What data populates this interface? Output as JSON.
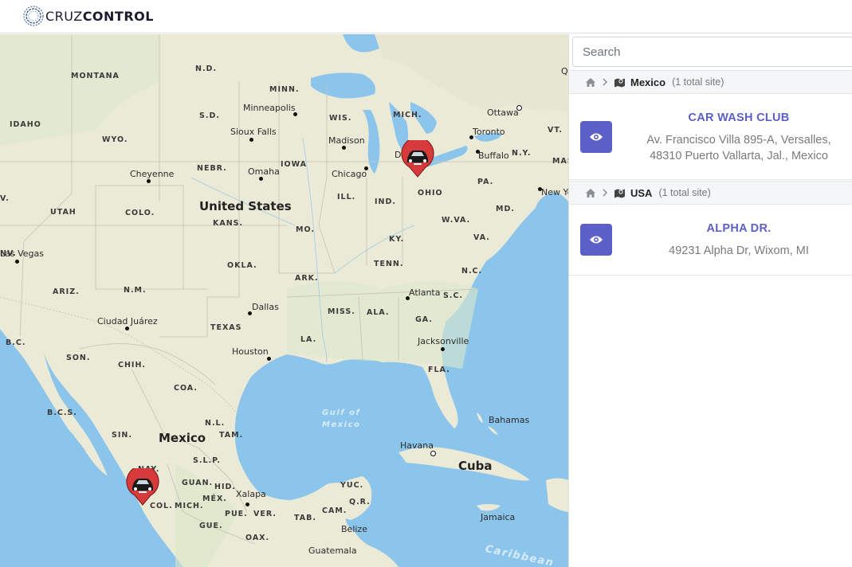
{
  "brand": {
    "name_light": "CRUZ",
    "name_bold": "CONTROL"
  },
  "search": {
    "placeholder": "Search",
    "value": ""
  },
  "groups": [
    {
      "country": "Mexico",
      "count": "(1 total site)",
      "sites": [
        {
          "title": "CAR WASH CLUB",
          "address_line1": "Av. Francisco Villa 895-A, Versalles,",
          "address_line2": "48310 Puerto Vallarta, Jal., Mexico"
        }
      ]
    },
    {
      "country": "USA",
      "count": "(1 total site)",
      "sites": [
        {
          "title": "ALPHA DR.",
          "address_line1": "49231 Alpha Dr, Wixom, MI",
          "address_line2": ""
        }
      ]
    }
  ],
  "map": {
    "countries": [
      "United States",
      "Mexico",
      "Cuba"
    ],
    "states": [
      "MONTANA",
      "N.D.",
      "MINN.",
      "IDAHO",
      "WYO.",
      "S.D.",
      "WIS.",
      "MICH.",
      "NEBR.",
      "IOWA",
      "UTAH",
      "COLO.",
      "KANS.",
      "MO.",
      "ILL.",
      "IND.",
      "OHIO",
      "PA.",
      "N.Y.",
      "VT.",
      "MASS",
      "W.VA.",
      "MD.",
      "VA.",
      "KY.",
      "TENN.",
      "N.C.",
      "OKLA.",
      "ARK.",
      "ARIZ.",
      "N.M.",
      "TEXAS",
      "MISS.",
      "ALA.",
      "GA.",
      "S.C.",
      "LA.",
      "FLA.",
      "B.C.",
      "SON.",
      "CHIH.",
      "COA.",
      "B.C.S.",
      "SIN.",
      "N.L.",
      "TAM.",
      "S.L.P.",
      "NAY.",
      "GUAN.",
      "HID.",
      "COL.",
      "MICH.",
      "MÉX.",
      "PUE.",
      "VER.",
      "GUE.",
      "OAX.",
      "TAB.",
      "CAM.",
      "YUC.",
      "Q.R.",
      "NV.",
      "V."
    ],
    "cities": [
      "Minneapolis",
      "Sioux Falls",
      "Madison",
      "Chicago",
      "Omaha",
      "Cheyenne",
      "Detroit",
      "Toronto",
      "Ottawa",
      "Buffalo",
      "New York",
      "Las Vegas",
      "Dallas",
      "Ciudad Juárez",
      "Houston",
      "Atlanta",
      "Jacksonville",
      "Havana",
      "Xalapa",
      "Belize",
      "Guatemala",
      "Bahamas",
      "Jamaica",
      "Qu"
    ],
    "water": [
      "Gulf of",
      "Mexico",
      "Caribbean"
    ]
  }
}
